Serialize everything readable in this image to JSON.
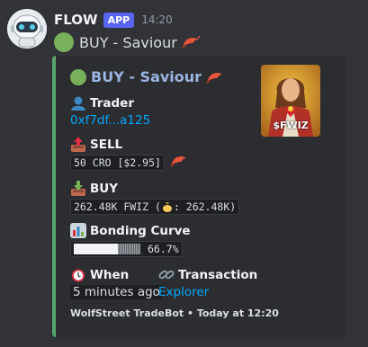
{
  "message": {
    "username": "FLOW",
    "badge": "APP",
    "timestamp": "14:20",
    "text": "BUY - Saviour"
  },
  "embed": {
    "title": "BUY - Saviour",
    "thumbnail_label": "$FWIZ",
    "accent_color": "#57a56f",
    "fields": {
      "trader_name": "Trader",
      "trader_value": "0xf7df...a125",
      "sell_name": "SELL",
      "sell_value": "50 CRO [$2.95]",
      "buy_name": "BUY",
      "buy_value_prefix": "262.48K FWIZ (",
      "buy_value_suffix": ": 262.48K)",
      "curve_name": "Bonding Curve",
      "curve_percent_text": "66.7%",
      "curve_fraction": 0.667,
      "when_name": "When",
      "when_value": "5 minutes ago",
      "tx_name": "Transaction",
      "tx_value": "Explorer"
    },
    "footer": "WolfStreet TradeBot • Today at 12:20"
  },
  "icons": {
    "avatar": "robot-avatar-icon",
    "green_circle": "green-circle-emoji",
    "shrimp": "shrimp-emoji",
    "trader": "bust-silhouette-emoji",
    "sell": "outbox-tray-emoji",
    "buy": "inbox-tray-emoji",
    "curve": "bar-chart-emoji",
    "when": "alarm-clock-emoji",
    "tx": "link-emoji",
    "money": "money-bag-emoji"
  }
}
